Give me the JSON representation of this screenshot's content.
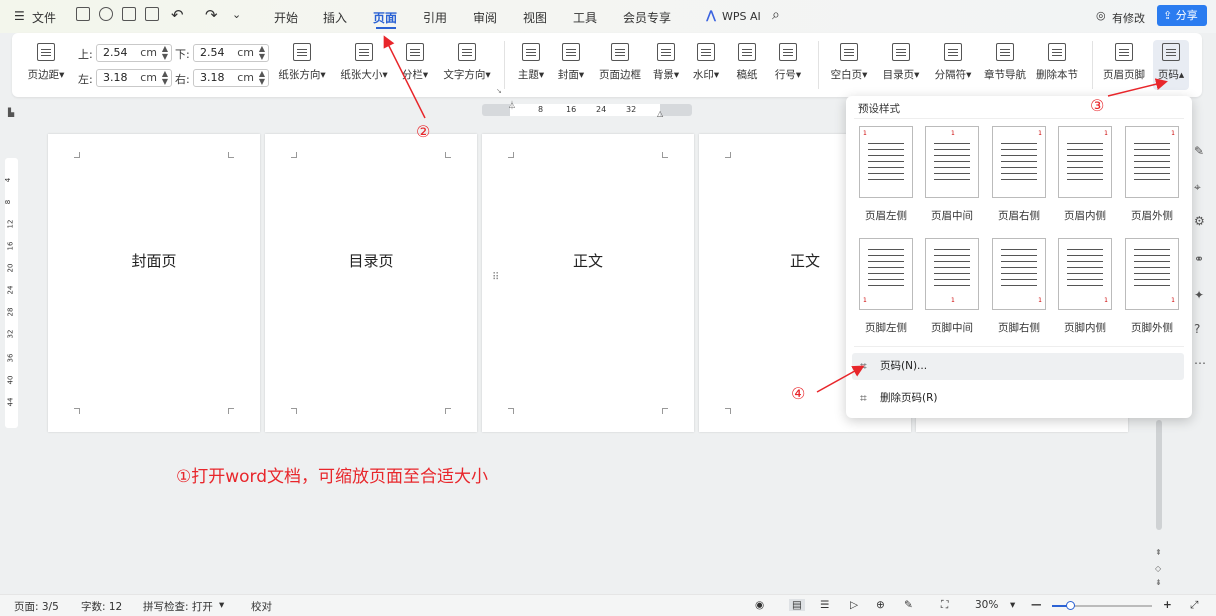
{
  "menubar": {
    "file": "文件",
    "tabs": [
      "开始",
      "插入",
      "页面",
      "引用",
      "审阅",
      "视图",
      "工具",
      "会员专享"
    ],
    "active_tab": "页面",
    "wps_ai": "WPS AI",
    "modified": "有修改",
    "share": "分享"
  },
  "ribbon": {
    "margin_btn": "页边距",
    "top_label": "上:",
    "top_value": "2.54",
    "bottom_label": "下:",
    "bottom_value": "2.54",
    "left_label": "左:",
    "left_value": "3.18",
    "right_label": "右:",
    "right_value": "3.18",
    "unit": "cm",
    "buttons": [
      "纸张方向",
      "纸张大小",
      "分栏",
      "文字方向",
      "主题",
      "封面",
      "页面边框",
      "背景",
      "水印",
      "稿纸",
      "行号",
      "空白页",
      "目录页",
      "分隔符",
      "章节导航",
      "删除本节",
      "页眉页脚",
      "页码"
    ]
  },
  "pages": [
    "封面页",
    "目录页",
    "正文",
    "正文"
  ],
  "hruler": [
    "8",
    "16",
    "24",
    "32"
  ],
  "vruler": [
    "4",
    "8",
    "12",
    "16",
    "20",
    "24",
    "28",
    "32",
    "36",
    "40",
    "44"
  ],
  "instruction": "①打开word文档，可缩放页面至合适大小",
  "steps": {
    "s2": "②",
    "s3": "③",
    "s4": "④"
  },
  "dropdown": {
    "title": "预设样式",
    "header_styles": [
      "页眉左侧",
      "页眉中间",
      "页眉右侧",
      "页眉内侧",
      "页眉外侧"
    ],
    "footer_styles": [
      "页脚左侧",
      "页脚中间",
      "页脚右侧",
      "页脚内侧",
      "页脚外侧"
    ],
    "page_number": "页码(N)...",
    "delete_page_number": "删除页码(R)"
  },
  "statusbar": {
    "page": "页面: 3/5",
    "words": "字数: 12",
    "spell": "拼写检查: 打开",
    "proof": "校对",
    "zoom": "30%"
  }
}
